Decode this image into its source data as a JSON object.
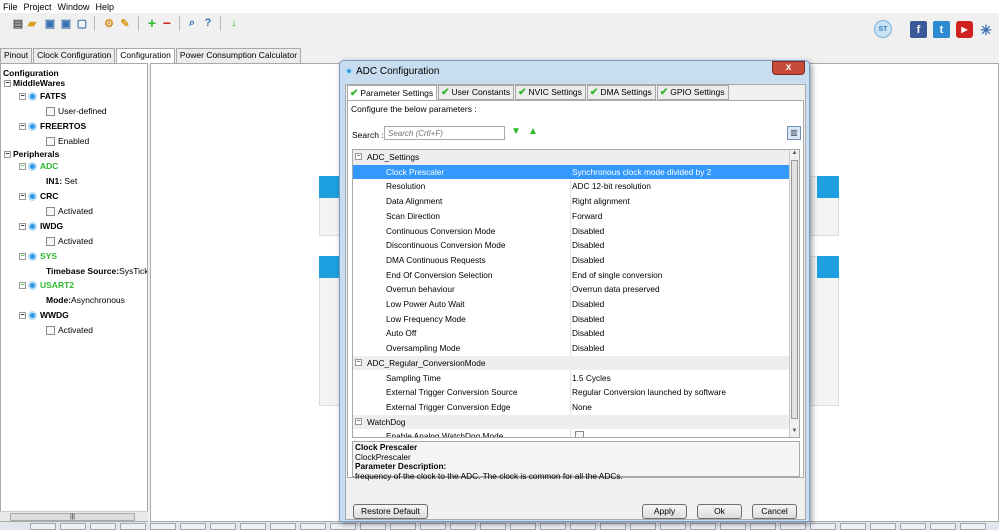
{
  "menubar": {
    "items": [
      "File",
      "Project",
      "Window",
      "Help"
    ]
  },
  "toolbar": {
    "icons": [
      "new-project-icon",
      "open-icon",
      "save-icon",
      "save-as-icon",
      "close-icon",
      "generate-code-icon",
      "generate-report-icon",
      "add-icon",
      "remove-icon",
      "zoom-icon",
      "help-icon",
      "download-icon",
      "st-logo-icon",
      "facebook-icon",
      "twitter-icon",
      "youtube-icon",
      "network-icon"
    ]
  },
  "main_tabs": [
    {
      "label": "Pinout",
      "active": false
    },
    {
      "label": "Clock Configuration",
      "active": false
    },
    {
      "label": "Configuration",
      "active": true
    },
    {
      "label": "Power Consumption Calculator",
      "active": false
    }
  ],
  "tree": {
    "root": "Configuration",
    "middlewares": {
      "label": "MiddleWares",
      "items": [
        {
          "name": "FATFS",
          "child": "User-defined",
          "child_type": "checkbox"
        },
        {
          "name": "FREERTOS",
          "child": "Enabled",
          "child_type": "checkbox"
        }
      ]
    },
    "peripherals": {
      "label": "Peripherals",
      "items": [
        {
          "name": "ADC",
          "green": true,
          "child_label": "IN1:",
          "child_value": " Set"
        },
        {
          "name": "CRC",
          "green": false,
          "child": "Activated",
          "child_type": "checkbox"
        },
        {
          "name": "IWDG",
          "green": false,
          "child": "Activated",
          "child_type": "checkbox"
        },
        {
          "name": "SYS",
          "green": true,
          "child_label": "Timebase Source:",
          "child_value": "SysTick"
        },
        {
          "name": "USART2",
          "green": true,
          "child_label": "Mode:",
          "child_value": "Asynchronous"
        },
        {
          "name": "WWDG",
          "green": false,
          "child": "Activated",
          "child_type": "checkbox"
        }
      ]
    },
    "scrollbar_grip": "|||"
  },
  "dialog": {
    "title": "ADC Configuration",
    "close_label": "x",
    "tabs": [
      {
        "label": "Parameter Settings",
        "active": true
      },
      {
        "label": "User Constants",
        "active": false
      },
      {
        "label": "NVIC Settings",
        "active": false
      },
      {
        "label": "DMA Settings",
        "active": false
      },
      {
        "label": "GPIO Settings",
        "active": false
      }
    ],
    "configure_label": "Configure the below parameters :",
    "search_label": "Search :",
    "search_placeholder": "Search (Crtl+F)",
    "groups": [
      {
        "name": "ADC_Settings",
        "params": [
          {
            "name": "Clock Prescaler",
            "value": "Synchronous clock mode divided by 2",
            "selected": true
          },
          {
            "name": "Resolution",
            "value": "ADC 12-bit resolution"
          },
          {
            "name": "Data Alignment",
            "value": "Right alignment"
          },
          {
            "name": "Scan Direction",
            "value": "Forward"
          },
          {
            "name": "Continuous Conversion Mode",
            "value": "Disabled"
          },
          {
            "name": "Discontinuous Conversion Mode",
            "value": "Disabled"
          },
          {
            "name": "DMA Continuous Requests",
            "value": "Disabled"
          },
          {
            "name": "End Of Conversion Selection",
            "value": "End of single conversion"
          },
          {
            "name": "Overrun behaviour",
            "value": "Overrun data preserved"
          },
          {
            "name": "Low Power Auto Wait",
            "value": "Disabled"
          },
          {
            "name": "Low Frequency Mode",
            "value": "Disabled"
          },
          {
            "name": "Auto Off",
            "value": "Disabled"
          },
          {
            "name": "Oversampling Mode",
            "value": "Disabled"
          }
        ]
      },
      {
        "name": "ADC_Regular_ConversionMode",
        "params": [
          {
            "name": "Sampling Time",
            "value": "1.5 Cycles"
          },
          {
            "name": "External Trigger Conversion Source",
            "value": "Regular Conversion launched by software"
          },
          {
            "name": "External Trigger Conversion Edge",
            "value": "None"
          }
        ]
      },
      {
        "name": "WatchDog",
        "params": [
          {
            "name": "Enable Analog WatchDog Mode",
            "value": "",
            "checkbox": true
          }
        ]
      }
    ],
    "description": {
      "title": "Clock Prescaler",
      "id": "ClockPrescaler",
      "heading": "Parameter Description:",
      "text": "frequency of the clock to the ADC. The clock is common for all the ADCs."
    },
    "buttons": {
      "restore": "Restore Default",
      "apply": "Apply",
      "ok": "Ok",
      "cancel": "Cancel"
    }
  },
  "colors": {
    "accent_green": "#2eb82e",
    "selection_blue": "#3399ff",
    "canvas_bar_blue": "#1ea0e0"
  }
}
